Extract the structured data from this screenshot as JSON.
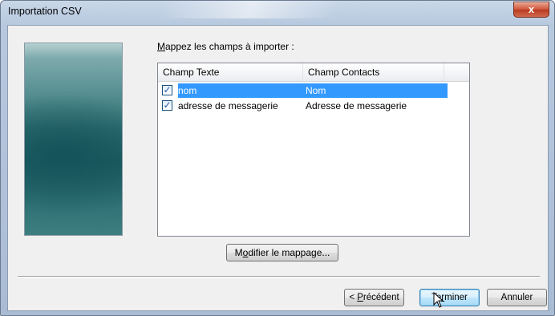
{
  "window": {
    "title": "Importation CSV",
    "close_label": "x"
  },
  "mapping": {
    "label_accel": "M",
    "label_rest": "appez les champs à importer :",
    "columns": [
      "Champ Texte",
      "Champ Contacts"
    ],
    "rows": [
      {
        "checked": true,
        "source": "nom",
        "target": "Nom",
        "selected": true
      },
      {
        "checked": true,
        "source": "adresse de messagerie",
        "target": "Adresse de messagerie",
        "selected": false
      }
    ],
    "modify_button": {
      "pre": "M",
      "accel": "o",
      "post": "difier le mappage..."
    }
  },
  "footer": {
    "prev": {
      "pre": "< ",
      "accel": "P",
      "post": "récédent"
    },
    "finish": {
      "pre": "Te",
      "accel": "r",
      "post": "miner"
    },
    "cancel": "Annuler"
  },
  "colors": {
    "selection": "#3399ff",
    "dialog_bg": "#f0f0f0",
    "close_button": "#c84a2e"
  }
}
